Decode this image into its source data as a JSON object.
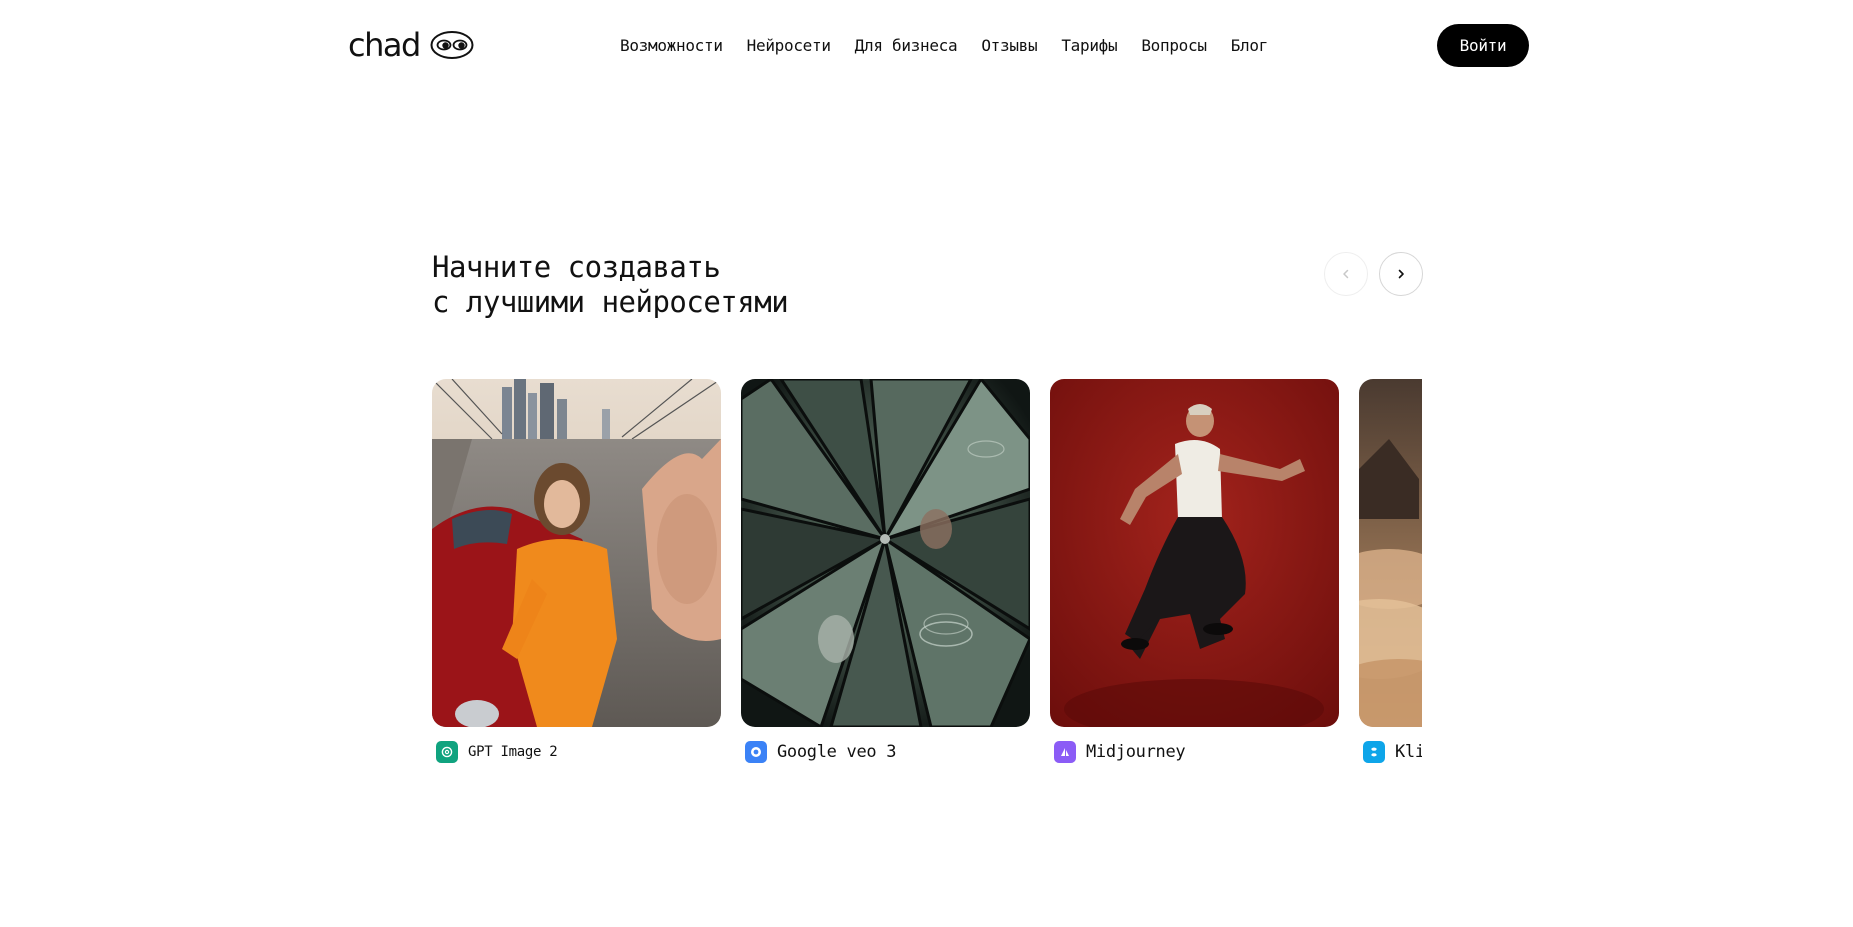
{
  "brand": {
    "name": "chad"
  },
  "nav": {
    "items": [
      "Возможности",
      "Нейросети",
      "Для бизнеса",
      "Отзывы",
      "Тарифы",
      "Вопросы",
      "Блог"
    ]
  },
  "auth": {
    "login_label": "Войти"
  },
  "hero": {
    "title_line1": "Начните создавать",
    "title_line2": "с лучшими нейросетями"
  },
  "carousel": {
    "cards": [
      {
        "model": "GPT Image 2",
        "icon": "openai-icon",
        "icon_color": "#10a37f"
      },
      {
        "model": "Google veo 3",
        "icon": "google-veo-icon",
        "icon_color": "#3b82f6"
      },
      {
        "model": "Midjourney",
        "icon": "midjourney-icon",
        "icon_color": "#8b5cf6"
      },
      {
        "model": "Kling",
        "icon": "kling-icon",
        "icon_color": "#0ea5e9"
      }
    ]
  },
  "colors": {
    "accent": "#000000",
    "background": "#ffffff"
  }
}
